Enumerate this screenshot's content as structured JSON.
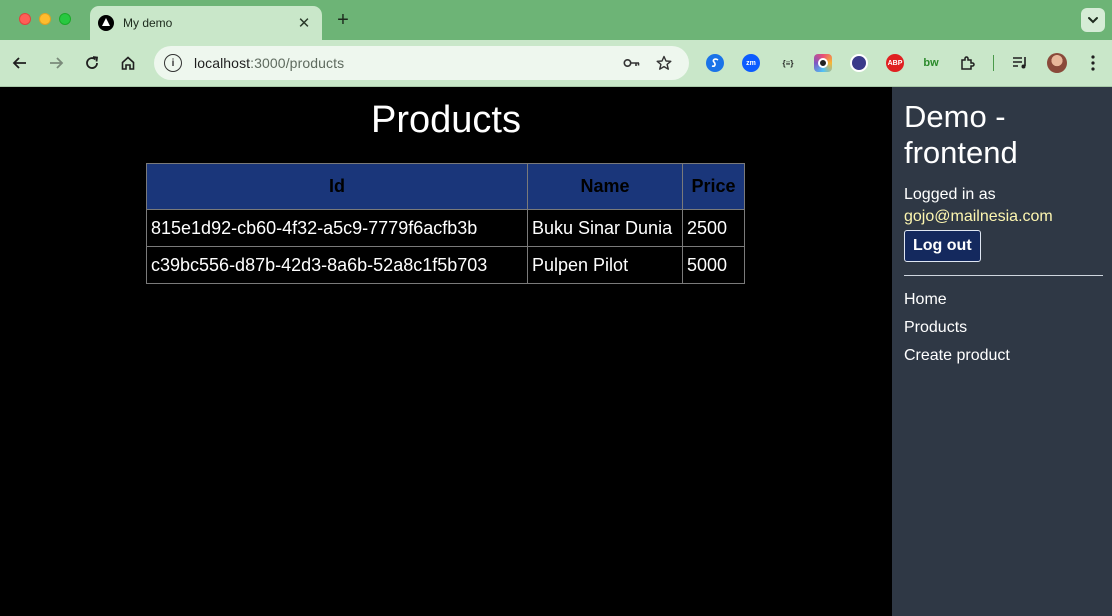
{
  "browser": {
    "tab_title": "My demo",
    "tab_close": "✕",
    "new_tab": "+",
    "url_host": "localhost",
    "url_path": ":3000/products",
    "extensions": [
      {
        "name": "s",
        "color": "#1a73e8"
      },
      {
        "name": "zm",
        "color": "#0b5cff"
      },
      {
        "name": "{≡}",
        "color": "#c9e7c9"
      },
      {
        "name": "",
        "color": "#e94e77"
      },
      {
        "name": "",
        "color": "#3a3a8a"
      },
      {
        "name": "ABP",
        "color": "#e02020"
      },
      {
        "name": "bw",
        "color": "#c9e7c9"
      }
    ]
  },
  "main": {
    "title": "Products",
    "table": {
      "headers": [
        "Id",
        "Name",
        "Price"
      ],
      "rows": [
        [
          "815e1d92-cb60-4f32-a5c9-7779f6acfb3b",
          "Buku Sinar Dunia",
          "2500"
        ],
        [
          "c39bc556-d87b-42d3-8a6b-52a8c1f5b703",
          "Pulpen Pilot",
          "5000"
        ]
      ]
    }
  },
  "sidebar": {
    "brand": "Demo - frontend",
    "logged_in_label": "Logged in as",
    "user_email": "gojo@mailnesia.com",
    "logout_label": "Log out",
    "nav": [
      "Home",
      "Products",
      "Create product"
    ]
  }
}
